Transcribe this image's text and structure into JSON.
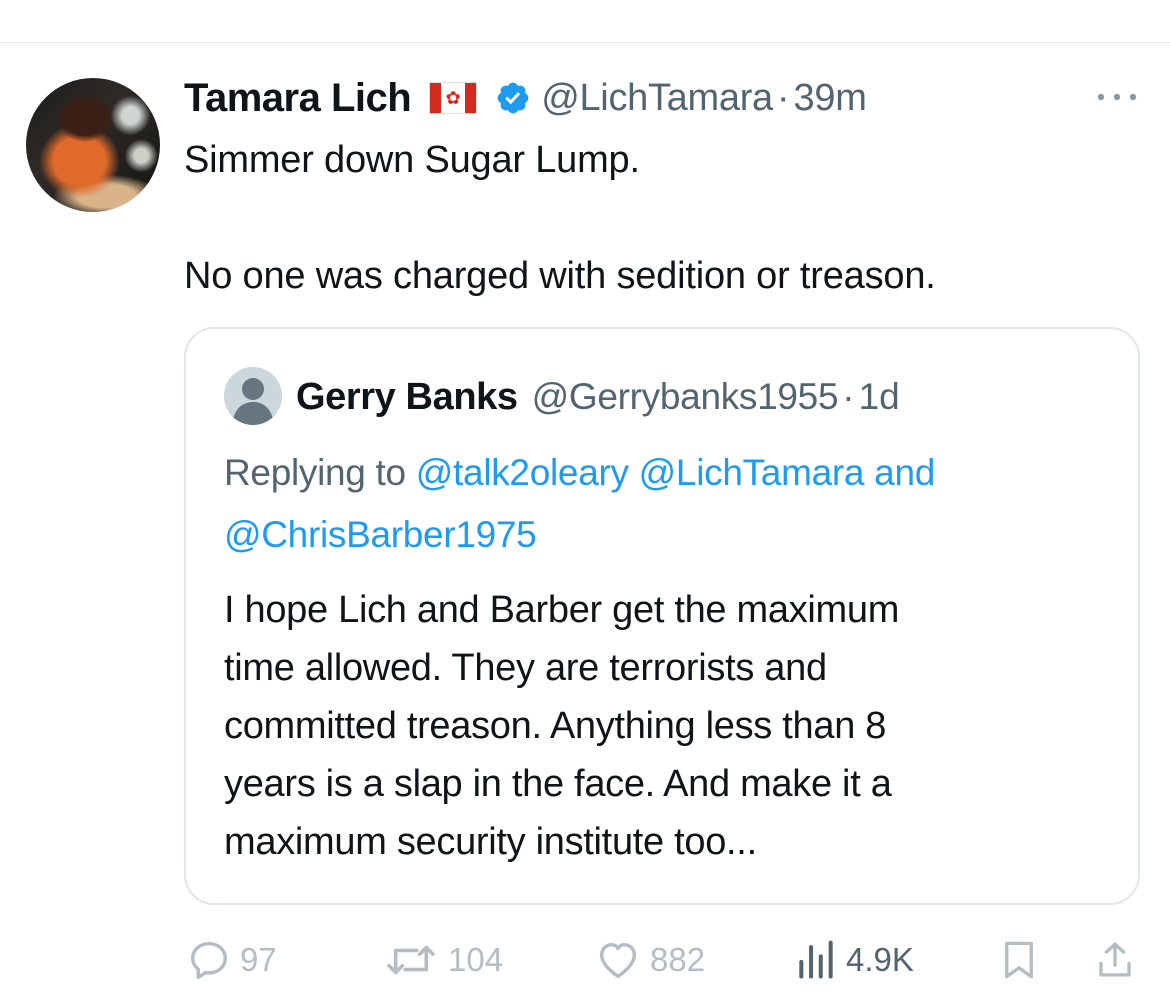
{
  "tweet": {
    "author_name": "Tamara Lich",
    "flag_icon": "canada-flag-icon",
    "verified": true,
    "handle": "@LichTamara",
    "separator": "·",
    "time": "39m",
    "text_lines": [
      "Simmer down Sugar Lump.",
      "No one was charged with sedition or treason."
    ]
  },
  "quote": {
    "author_name": "Gerry Banks",
    "handle": "@Gerrybanks1955",
    "separator": "·",
    "time": "1d",
    "replying_prefix": "Replying to",
    "mention_1": "@talk2oleary",
    "mention_2": "@LichTamara",
    "mention_joiner": "and",
    "mention_3": "@ChrisBarber1975",
    "body_lines": [
      "I hope Lich and Barber get the maximum",
      "time allowed. They are terrorists and",
      "committed treason. Anything less than 8",
      "years is a slap in the face. And make it a",
      "maximum security institute too..."
    ]
  },
  "actions": {
    "replies": "97",
    "reposts": "104",
    "likes": "882",
    "views": "4.9K"
  },
  "colors": {
    "text": "#0f1419",
    "secondary": "#536471",
    "link": "#1d9bf0",
    "verified": "#1d9bf0",
    "flag_red": "#d52b1e",
    "faded_action": "#b4bdc4"
  }
}
